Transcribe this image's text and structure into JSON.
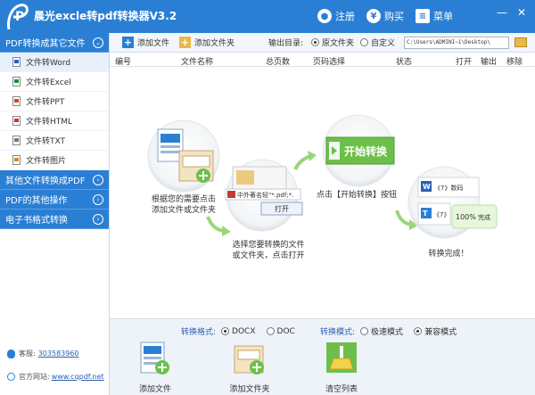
{
  "titlebar": {
    "title": "晨光excle转pdf转换器V3.2",
    "register": "注册",
    "buy": "购买",
    "menu": "菜单",
    "logo_letter": "P",
    "minimize": "—",
    "close": "✕"
  },
  "sidebar": {
    "categories": [
      {
        "label": "PDF转换成其它文件"
      },
      {
        "label": "其他文件转换成PDF"
      },
      {
        "label": "PDF的其他操作"
      },
      {
        "label": "电子书格式转换"
      }
    ],
    "items": [
      {
        "label": "文件转Word"
      },
      {
        "label": "文件转Excel"
      },
      {
        "label": "文件转PPT"
      },
      {
        "label": "文件转HTML"
      },
      {
        "label": "文件转TXT"
      },
      {
        "label": "文件转图片"
      }
    ],
    "qq_label": "客服:",
    "qq_number": "303583960",
    "site_label": "官方网站:",
    "site_url": "www.cqpdf.net"
  },
  "toolbar": {
    "add_file": "添加文件",
    "add_folder": "添加文件夹",
    "output_label": "输出目录:",
    "opt_original": "原文件夹",
    "opt_custom": "自定义",
    "path": "C:\\Users\\ADMINI~1\\Desktop\\"
  },
  "table": {
    "headers": [
      "编号",
      "文件名称",
      "总页数",
      "页码选择",
      "状态",
      "打开",
      "输出",
      "移除"
    ]
  },
  "guide": {
    "step1": "根据您的需要点击\n添加文件或文件夹",
    "step2_dialog_name": "中外著名轻\"*.pdf;*.",
    "step2_open": "打开",
    "step2": "选择您要转换的文件\n或文件夹，点击打开",
    "step3_button": "开始转换",
    "step3": "点击【开始转换】按钮",
    "step4_row1": "《7》数码",
    "step4_row2": "《7》",
    "step4_done_pct": "100%",
    "step4_done": "完成",
    "step4": "转换完成！"
  },
  "options": {
    "format_label": "转换格式:",
    "format_docx": "DOCX",
    "format_doc": "DOC",
    "mode_label": "转换模式:",
    "mode_fast": "极速模式",
    "mode_compat": "兼容模式"
  },
  "bottom_buttons": {
    "add_file": "添加文件",
    "add_folder": "添加文件夹",
    "clear_list": "清空列表"
  },
  "colors": {
    "primary": "#2a7fd4",
    "accent_green": "#6cc04a",
    "link": "#2a5fb5"
  }
}
